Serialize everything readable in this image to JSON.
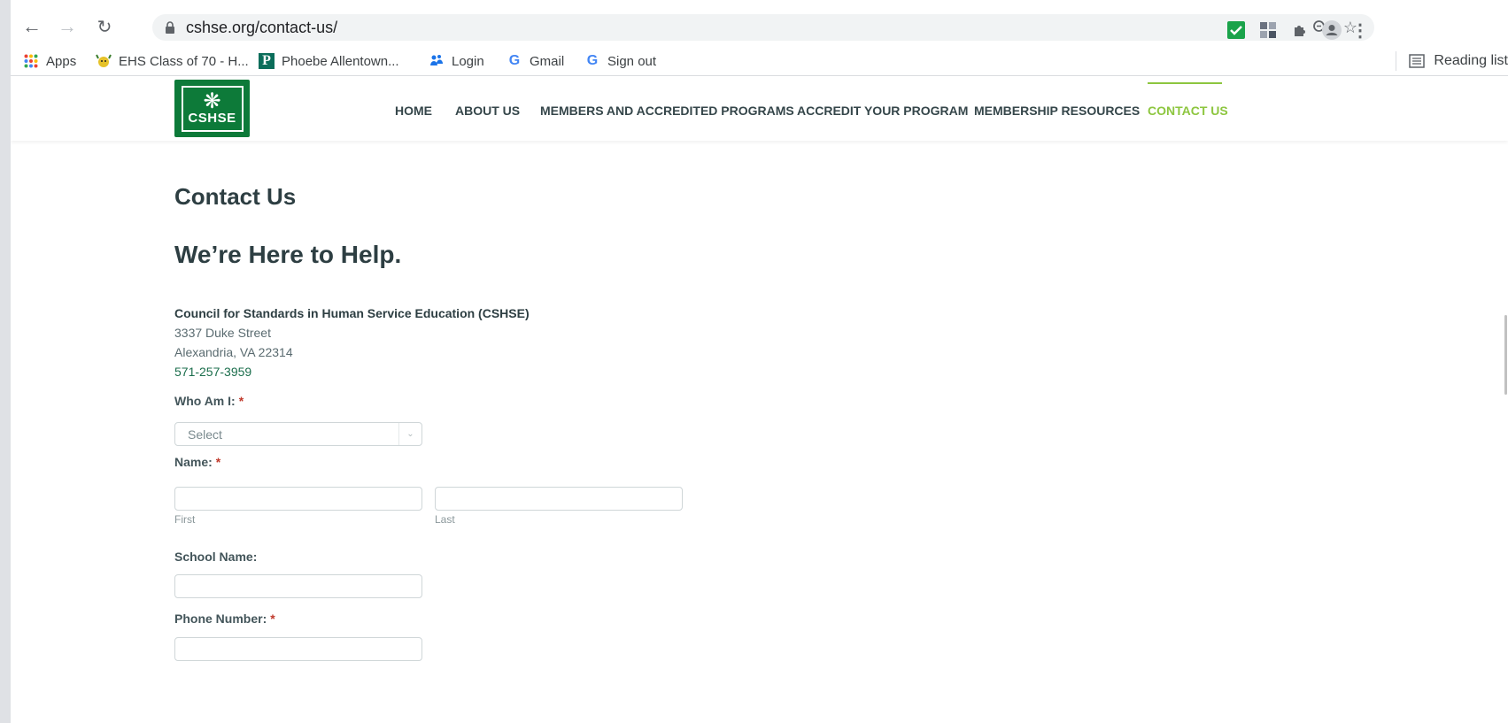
{
  "browser": {
    "url": "cshse.org/contact-us/",
    "bookmarks": [
      {
        "label": "Apps",
        "icon": "apps-grid-icon"
      },
      {
        "label": "EHS Class of 70 - H...",
        "icon": "mascot-icon"
      },
      {
        "label": "Phoebe Allentown...",
        "icon": "p-logo-icon"
      },
      {
        "label": "Login",
        "icon": "people-icon"
      },
      {
        "label": "Gmail",
        "icon": "google-icon"
      },
      {
        "label": "Sign out",
        "icon": "google-icon"
      }
    ],
    "reading_list": "Reading list"
  },
  "site": {
    "logo_text": "CSHSE",
    "nav": [
      {
        "label": "HOME"
      },
      {
        "label": "ABOUT US"
      },
      {
        "label": "MEMBERS AND ACCREDITED PROGRAMS"
      },
      {
        "label": "ACCREDIT YOUR PROGRAM"
      },
      {
        "label": "MEMBERSHIP RESOURCES"
      },
      {
        "label": "CONTACT US",
        "active": true
      }
    ],
    "accent_color": "#8dc63f",
    "brand_color": "#0d7a39"
  },
  "page": {
    "title": "Contact Us",
    "heading": "We’re Here to Help.",
    "address": {
      "org": "Council for Standards in Human Service Education (CSHSE)",
      "street": "3337 Duke Street",
      "city": "Alexandria, VA 22314",
      "phone": "571-257-3959"
    },
    "form": {
      "who_label": "Who Am I:",
      "who_placeholder": "Select",
      "name_label": "Name:",
      "first_sub": "First",
      "last_sub": "Last",
      "school_label": "School Name:",
      "phone_label": "Phone Number:",
      "required_mark": "*"
    }
  }
}
